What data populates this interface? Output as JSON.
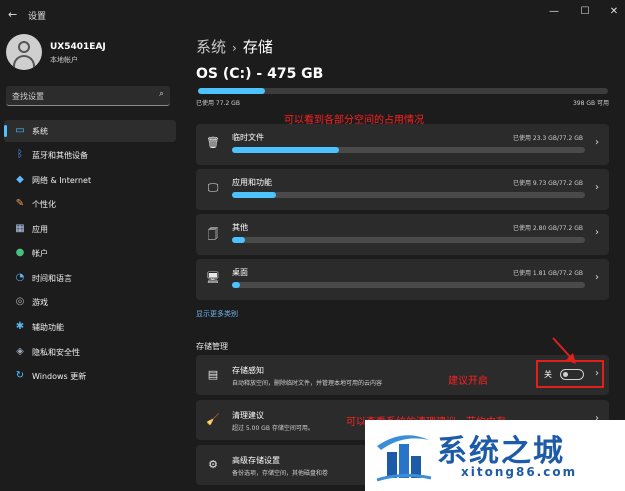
{
  "window": {
    "title": "设置",
    "back_icon": "←",
    "minimize_icon": "—",
    "maximize_icon": "☐",
    "close_icon": "✕"
  },
  "user": {
    "name": "UX5401EAJ",
    "account_type": "本地帐户"
  },
  "search": {
    "placeholder": "查找设置",
    "icon": "⌕"
  },
  "sidebar": {
    "items": [
      {
        "label": "系统",
        "icon": "▭",
        "icon_color": "#4cc2ff",
        "active": true
      },
      {
        "label": "蓝牙和其他设备",
        "icon": "ᛒ",
        "icon_color": "#4c9aff",
        "active": false
      },
      {
        "label": "网络 & Internet",
        "icon": "◆",
        "icon_color": "#60b8ff",
        "active": false
      },
      {
        "label": "个性化",
        "icon": "✎",
        "icon_color": "#f0a05a",
        "active": false
      },
      {
        "label": "应用",
        "icon": "▦",
        "icon_color": "#b0c8e8",
        "active": false
      },
      {
        "label": "帐户",
        "icon": "●",
        "icon_color": "#48c080",
        "active": false
      },
      {
        "label": "时间和语言",
        "icon": "◔",
        "icon_color": "#5ab4f0",
        "active": false
      },
      {
        "label": "游戏",
        "icon": "◎",
        "icon_color": "#b0b0b0",
        "active": false
      },
      {
        "label": "辅助功能",
        "icon": "✱",
        "icon_color": "#5ab4f0",
        "active": false
      },
      {
        "label": "隐私和安全性",
        "icon": "◈",
        "icon_color": "#9aa8b8",
        "active": false
      },
      {
        "label": "Windows 更新",
        "icon": "↻",
        "icon_color": "#4cc2ff",
        "active": false
      }
    ]
  },
  "breadcrumb": {
    "parent": "系统",
    "separator": "›",
    "current": "存储"
  },
  "drive": {
    "title": "OS (C:) - 475 GB",
    "used_label": "已使用 77.2 GB",
    "free_label": "398 GB 可用",
    "used_fraction": 0.1625
  },
  "categories": [
    {
      "label": "临时文件",
      "icon": "🗑",
      "value": "已使用 23.3 GB/77.2 GB",
      "fraction": 0.302
    },
    {
      "label": "应用和功能",
      "icon": "🖵",
      "value": "已使用 9.73 GB/77.2 GB",
      "fraction": 0.126
    },
    {
      "label": "其他",
      "icon": "🗍",
      "value": "已使用 2.80 GB/77.2 GB",
      "fraction": 0.036
    },
    {
      "label": "桌面",
      "icon": "🖥",
      "value": "已使用 1.81 GB/77.2 GB",
      "fraction": 0.023
    }
  ],
  "chevron": "›",
  "more_link": "显示更多类别",
  "management": {
    "section_title": "存储管理",
    "items": [
      {
        "label": "存储感知",
        "icon": "▤",
        "desc": "自动释放空间，删除临时文件，并管理本地可用的云内容",
        "toggle": {
          "state_label": "关",
          "on": false
        }
      },
      {
        "label": "清理建议",
        "icon": "🧹",
        "desc": "超过 5.00 GB 存储空间可用。"
      },
      {
        "label": "高级存储设置",
        "icon": "⚙",
        "desc": "备份选项，存储空间，其他磁盘和卷"
      }
    ]
  },
  "annotations": {
    "top": "可以看到各部分空间的占用情况",
    "sense": "建议开启",
    "cleanup": "可以查看系统的清理建议，节约内存"
  },
  "annotation_color": "#ff2020",
  "watermark": {
    "text": "系统之城",
    "url": "xitong86.com"
  }
}
